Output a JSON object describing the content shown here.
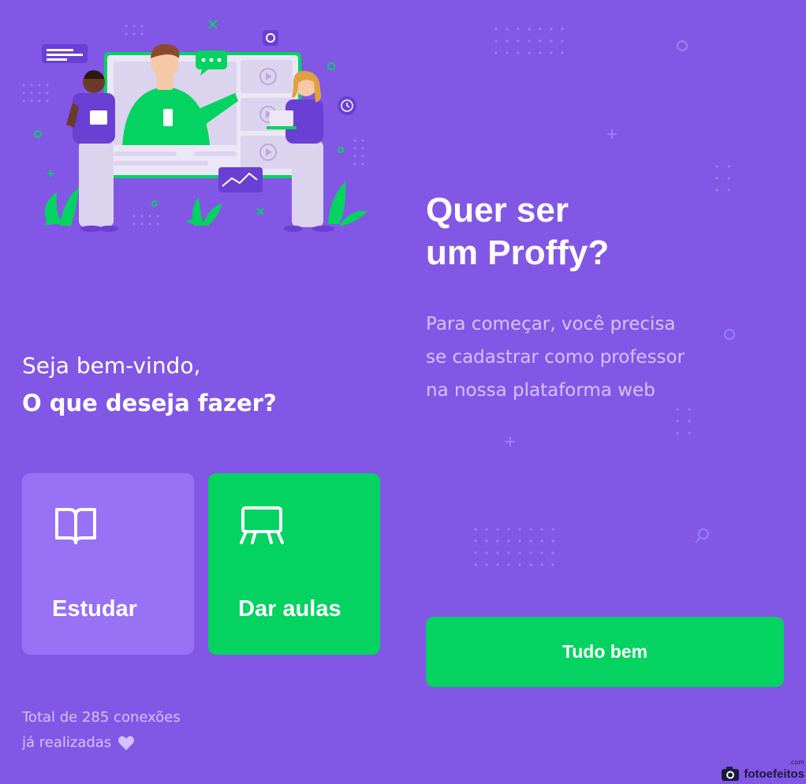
{
  "welcome": {
    "line1": "Seja bem-vindo,",
    "line2": "O que deseja fazer?"
  },
  "actions": [
    {
      "label": "Estudar",
      "icon": "book-icon"
    },
    {
      "label": "Dar aulas",
      "icon": "whiteboard-icon"
    }
  ],
  "connections": {
    "line1": "Total de 285 conexões",
    "line2": "já realizadas",
    "icon": "heart-icon"
  },
  "cta": {
    "title_line1": "Quer ser",
    "title_line2": "um Proffy?",
    "desc_line1": "Para começar, você precisa",
    "desc_line2": "se cadastrar como professor",
    "desc_line3": "na nossa plataforma web",
    "button_label": "Tudo bem"
  },
  "watermark": {
    "text": "fotoefeitos",
    "sub": ".com"
  },
  "colors": {
    "background": "#8257E5",
    "tile_study": "#9871F5",
    "tile_teach": "#04D361",
    "button": "#04D361",
    "muted_text": "#D4C2FF"
  }
}
